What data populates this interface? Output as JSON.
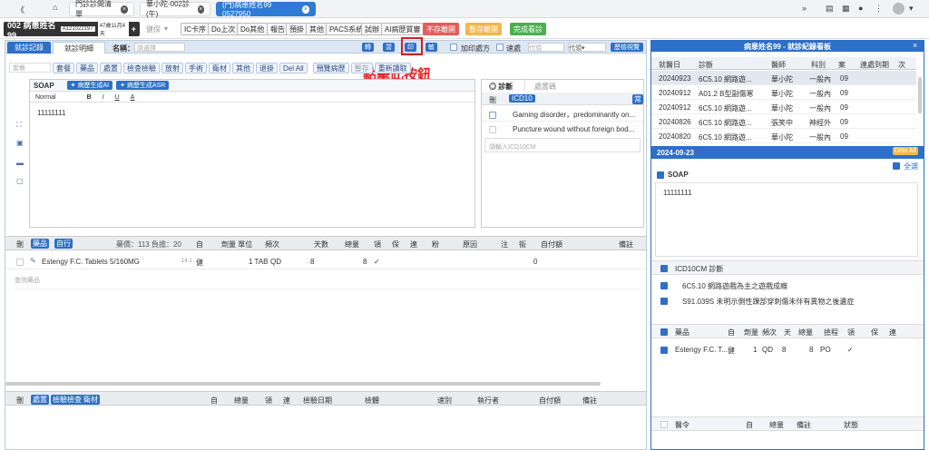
{
  "topbar": {
    "tabs": [
      "門診診間清單",
      "華小陀-002診(午)",
      "(門)病患姓名99 0527950"
    ],
    "nav_back": "《",
    "home": "⌂"
  },
  "patient": {
    "name": "002 病患姓名99",
    "id": "A121022197",
    "age": "47歲11月4天",
    "add": "+"
  },
  "toolbar": {
    "buttons": [
      "健保",
      "IC卡序",
      "Do上次",
      "Do其他",
      "報告",
      "預掛",
      "其他",
      "PACS系統",
      "試辦",
      "AI病歷質審"
    ],
    "no_save": "不存離開",
    "temp_save": "暫存離開",
    "done": "完成看診"
  },
  "left": {
    "tabs": [
      "就診記錄",
      "就診明細"
    ],
    "name_label": "名稱：",
    "name_placeholder": "請選擇",
    "actions": {
      "turn": "轉",
      "print_left": "習",
      "print": "印",
      "sensitive": "敏",
      "add_print": "加印處方",
      "urgent": "速處",
      "sel1": "代領",
      "sel2": "代領▾",
      "view_table": "歷檢視覽"
    },
    "annotation": "點擊此按鈕",
    "row2": {
      "placeholder": "套餐",
      "buttons": [
        "套餐",
        "藥品",
        "處置",
        "檢查檢驗",
        "放射",
        "手術",
        "衛材",
        "其他",
        "退掛",
        "Del All",
        "預覽病歷",
        "暫存",
        "重新讀取"
      ]
    },
    "soap": {
      "label": "SOAP",
      "ai1": "病歷生成AI",
      "ai2": "病歷生成ASR",
      "format": "Normal",
      "bold": "B",
      "italic": "I",
      "underline": "U",
      "color": "A",
      "content": "11111111"
    },
    "diag": {
      "tab1": "診斷",
      "tab2": "處置碼",
      "del": "刪",
      "icd": "ICD10",
      "frequent": "常",
      "items": [
        "Gaming disorder，predominantly on...",
        "Puncture wound without foreign bod..."
      ],
      "input": "請輸入ICD10CM"
    },
    "meds": {
      "del": "刪",
      "cat1": "藥品",
      "cat2": "自行",
      "summary": "藥價：113 負擔：20",
      "headers": [
        "自",
        "劑量 單位",
        "頻次",
        "天數",
        "總量",
        "領",
        "保",
        "連",
        "粉",
        "原因",
        "注",
        "銜",
        "自付額",
        "備註"
      ],
      "row": {
        "name": "Estengy F.C. Tablets 5/160MG",
        "price": "14.1",
        "tag": "健",
        "dose": "1 TAB",
        "freq": "QD",
        "days": "8",
        "total": "8",
        "take": "✓",
        "self_pay": "0"
      },
      "search": "查詢藥品"
    },
    "exams": {
      "del": "刪",
      "cat1": "處置",
      "cat2": "檢驗檢查",
      "cat3": "衛材",
      "headers": [
        "自",
        "總量",
        "領",
        "連",
        "檢驗日期",
        "檢體",
        "速別",
        "執行者",
        "自付額",
        "備註"
      ]
    }
  },
  "right": {
    "title": "病患姓名99 - 就診紀錄看板",
    "close": "×",
    "headers": [
      "就醫日",
      "診斷",
      "醫師",
      "科別",
      "案",
      "連處到期",
      "次"
    ],
    "rows": [
      [
        "20240923",
        "6C5.10 網路遊...",
        "華小陀",
        "一般內",
        "09"
      ],
      [
        "20240912",
        "A01.2 B型副傷寒",
        "華小陀",
        "一般內",
        "09"
      ],
      [
        "20240912",
        "6C5.10 網路遊...",
        "華小陀",
        "一般內",
        "09"
      ],
      [
        "20240826",
        "6C5.10 網路遊...",
        "張笑中",
        "神經外",
        "09"
      ],
      [
        "20240820",
        "6C5.10 網路遊...",
        "華小陀",
        "一般內",
        "09"
      ]
    ],
    "date": "2024-09-23",
    "ditto": "Ditto All",
    "select_all": "全選",
    "soap": "SOAP",
    "soap_text": "11111111",
    "icd_title": "ICD10CM 診斷",
    "icd": [
      "6C5.10 網路遊戲為主之遊戲成癮",
      "S91.039S 未明示側性踝部穿刺傷未伴有異物之後遺症"
    ],
    "med_headers": [
      "藥品",
      "自",
      "劑量",
      "頻次",
      "天",
      "總量",
      "撿程",
      "領",
      "保",
      "連"
    ],
    "med_row": {
      "name": "Estengy F.C. T...",
      "tag": "健",
      "dose": "1",
      "freq": "QD",
      "days": "8",
      "total": "8",
      "route": "PO",
      "take": "✓"
    },
    "order_headers": [
      "醫令",
      "自",
      "總量",
      "備註",
      "狀態"
    ]
  }
}
